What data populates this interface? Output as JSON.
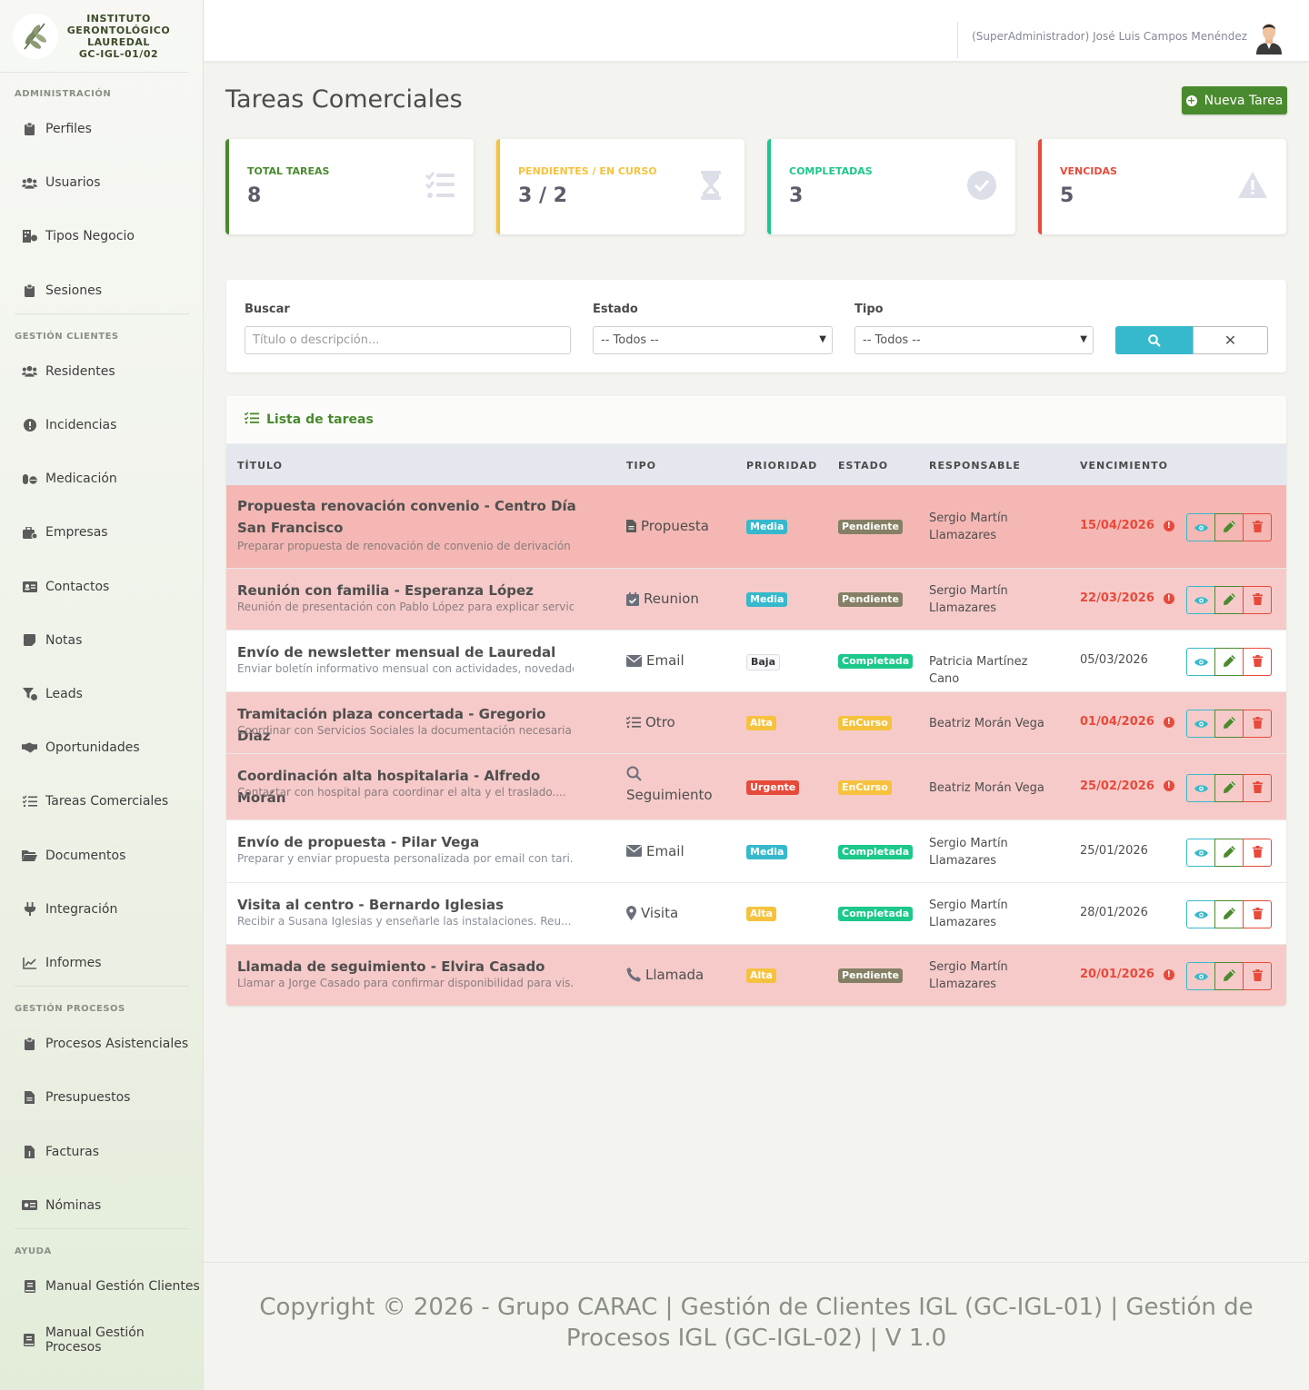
{
  "brand": {
    "line1": "INSTITUTO",
    "line2": "GERONTOLÓGICO",
    "line3": "LAUREDAL",
    "line4": "GC-IGL-01/02"
  },
  "sidebar": {
    "sections": [
      {
        "title": "ADMINISTRACIÓN",
        "items": [
          {
            "label": "Perfiles",
            "icon": "clipboard-icon"
          },
          {
            "label": "Usuarios",
            "icon": "users-icon"
          },
          {
            "label": "Tipos Negocio",
            "icon": "building-icon"
          },
          {
            "label": "Sesiones",
            "icon": "clipboard-icon"
          }
        ]
      },
      {
        "title": "GESTIÓN CLIENTES",
        "items": [
          {
            "label": "Residentes",
            "icon": "users-icon"
          },
          {
            "label": "Incidencias",
            "icon": "alert-icon"
          },
          {
            "label": "Medicación",
            "icon": "pills-icon"
          },
          {
            "label": "Empresas",
            "icon": "briefcase-icon"
          },
          {
            "label": "Contactos",
            "icon": "id-card-icon"
          },
          {
            "label": "Notas",
            "icon": "note-icon"
          },
          {
            "label": "Leads",
            "icon": "funnel-icon"
          },
          {
            "label": "Oportunidades",
            "icon": "handshake-icon"
          },
          {
            "label": "Tareas Comerciales",
            "icon": "tasks-icon"
          },
          {
            "label": "Documentos",
            "icon": "folder-icon"
          },
          {
            "label": "Integración",
            "icon": "plug-icon"
          },
          {
            "label": "Informes",
            "icon": "chart-icon"
          }
        ]
      },
      {
        "title": "GESTIÓN PROCESOS",
        "items": [
          {
            "label": "Procesos Asistenciales",
            "icon": "clipboard-icon"
          },
          {
            "label": "Presupuestos",
            "icon": "file-icon"
          },
          {
            "label": "Facturas",
            "icon": "invoice-icon"
          },
          {
            "label": "Nóminas",
            "icon": "money-icon"
          }
        ]
      },
      {
        "title": "AYUDA",
        "items": [
          {
            "label": "Manual Gestión Clientes",
            "icon": "book-icon"
          },
          {
            "label": "Manual Gestión Procesos",
            "icon": "book-icon"
          }
        ]
      }
    ]
  },
  "header": {
    "user": "(SuperAdministrador) José Luis Campos Menéndez"
  },
  "page": {
    "title": "Tareas Comerciales",
    "new_button": "Nueva Tarea"
  },
  "stats": [
    {
      "label": "TOTAL TAREAS",
      "value": "8",
      "color": "#4a8a2e",
      "icon": "tasks-icon"
    },
    {
      "label": "PENDIENTES / EN CURSO",
      "value": "3 / 2",
      "color": "#f6c23e",
      "icon": "hourglass-icon"
    },
    {
      "label": "COMPLETADAS",
      "value": "3",
      "color": "#1cc88a",
      "icon": "check-circle-icon"
    },
    {
      "label": "VENCIDAS",
      "value": "5",
      "color": "#e74a3b",
      "icon": "warning-icon"
    }
  ],
  "filters": {
    "search_label": "Buscar",
    "search_placeholder": "Título o descripción...",
    "estado_label": "Estado",
    "estado_value": "-- Todos --",
    "tipo_label": "Tipo",
    "tipo_value": "-- Todos --",
    "clear_symbol": "✕"
  },
  "list": {
    "title": "Lista de tareas",
    "columns": [
      "TÍTULO",
      "TIPO",
      "PRIORIDAD",
      "ESTADO",
      "RESPONSABLE",
      "VENCIMIENTO"
    ],
    "rows": [
      {
        "title": "Propuesta renovación convenio - Centro Día San Francisco",
        "desc": "Preparar propuesta de renovación de convenio de derivación c...",
        "type": "Propuesta",
        "type_icon": "file-icon",
        "priority": "Media",
        "status": "Pendiente",
        "resp": "Sergio Martín Llamazares",
        "due": "15/04/2026",
        "overdue": true
      },
      {
        "title": "Reunión con familia - Esperanza López",
        "desc": "Reunión de presentación con Pablo López para explicar servic...",
        "type": "Reunion",
        "type_icon": "calendar-check-icon",
        "priority": "Media",
        "status": "Pendiente",
        "resp": "Sergio Martín Llamazares",
        "due": "22/03/2026",
        "overdue": true
      },
      {
        "title": "Envío de newsletter mensual de Lauredal",
        "desc": "Enviar boletín informativo mensual con actividades, novedade...",
        "type": "Email",
        "type_icon": "envelope-icon",
        "priority": "Baja",
        "status": "Completada",
        "resp": "Patricia Martínez Cano",
        "due": "05/03/2026",
        "overdue": false
      },
      {
        "title": "Tramitación plaza concertada - Gregorio Díaz",
        "desc": "Coordinar con Servicios Sociales la documentación necesaria ...",
        "type": "Otro",
        "type_icon": "tasks-icon",
        "priority": "Alta",
        "status": "EnCurso",
        "resp": "Beatriz Morán Vega",
        "due": "01/04/2026",
        "overdue": true
      },
      {
        "title": "Coordinación alta hospitalaria - Alfredo Morán",
        "desc": "Contactar con hospital para coordinar el alta y el traslado....",
        "type": "Seguimiento",
        "type_icon": "search-icon",
        "priority": "Urgente",
        "status": "EnCurso",
        "resp": "Beatriz Morán Vega",
        "due": "25/02/2026",
        "overdue": true
      },
      {
        "title": "Envío de propuesta - Pilar Vega",
        "desc": "Preparar y enviar propuesta personalizada por email con tari...",
        "type": "Email",
        "type_icon": "envelope-icon",
        "priority": "Media",
        "status": "Completada",
        "resp": "Sergio Martín Llamazares",
        "due": "25/01/2026",
        "overdue": false
      },
      {
        "title": "Visita al centro - Bernardo Iglesias",
        "desc": "Recibir a Susana Iglesias y enseñarle las instalaciones. Reu...",
        "type": "Visita",
        "type_icon": "map-marker-icon",
        "priority": "Alta",
        "status": "Completada",
        "resp": "Sergio Martín Llamazares",
        "due": "28/01/2026",
        "overdue": false
      },
      {
        "title": "Llamada de seguimiento - Elvira Casado",
        "desc": "Llamar a Jorge Casado para confirmar disponibilidad para vis...",
        "type": "Llamada",
        "type_icon": "phone-icon",
        "priority": "Alta",
        "status": "Pendiente",
        "resp": "Sergio Martín Llamazares",
        "due": "20/01/2026",
        "overdue": true
      }
    ]
  },
  "footer": {
    "text": "Copyright © 2026 - Grupo CARAC | Gestión de Clientes IGL (GC-IGL-01) | Gestión de Procesos IGL (GC-IGL-02) | V 1.0"
  }
}
